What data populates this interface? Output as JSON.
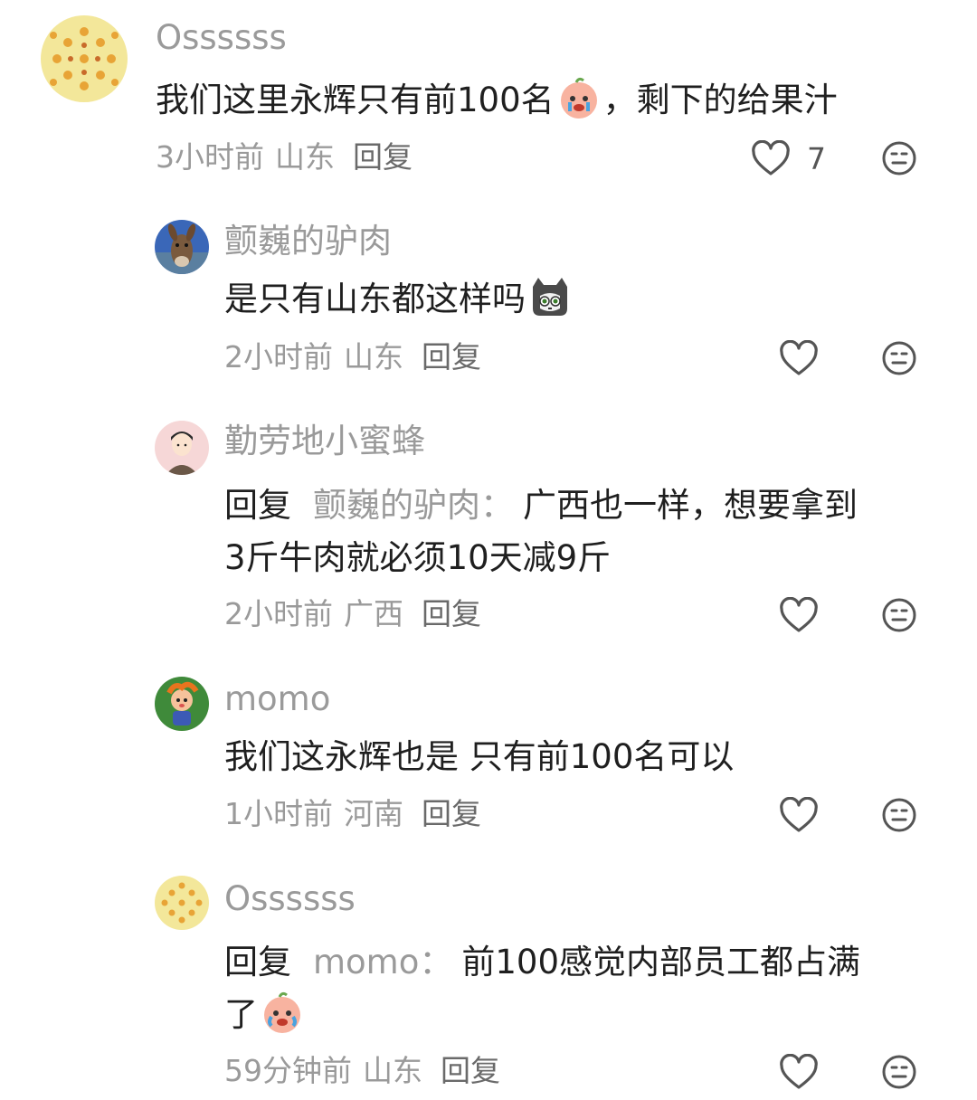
{
  "comments": [
    {
      "username": "Ossssss",
      "text_before_emoji": "我们这里永辉只有前100名",
      "text_after_emoji": "，剩下的给果汁",
      "time": "3小时前",
      "location": "山东",
      "reply_label": "回复",
      "like_count": "7"
    },
    {
      "username": "颤巍的驴肉",
      "text_before_emoji": "是只有山东都这样吗",
      "time": "2小时前",
      "location": "山东",
      "reply_label": "回复"
    },
    {
      "username": "勤劳地小蜜蜂",
      "reply_prefix": "回复",
      "reply_target": "颤巍的驴肉",
      "colon": "：",
      "text_line1": "广西也一样，想要拿到",
      "text_line2": "3斤牛肉就必须10天减9斤",
      "time": "2小时前",
      "location": "广西",
      "reply_label": "回复"
    },
    {
      "username": "momo",
      "text": "我们这永辉也是 只有前100名可以",
      "time": "1小时前",
      "location": "河南",
      "reply_label": "回复"
    },
    {
      "username": "Ossssss",
      "reply_prefix": "回复",
      "reply_target": "momo",
      "colon": "：",
      "text_line1": "前100感觉内部员工都占满",
      "text_line2": "了",
      "time": "59分钟前",
      "location": "山东",
      "reply_label": "回复"
    }
  ],
  "icons": {
    "like": "heart-outline-icon",
    "dislike": "neutral-face-icon"
  },
  "colors": {
    "text": "#1f1f1f",
    "muted": "#9a9a9a",
    "icon": "#555555"
  }
}
